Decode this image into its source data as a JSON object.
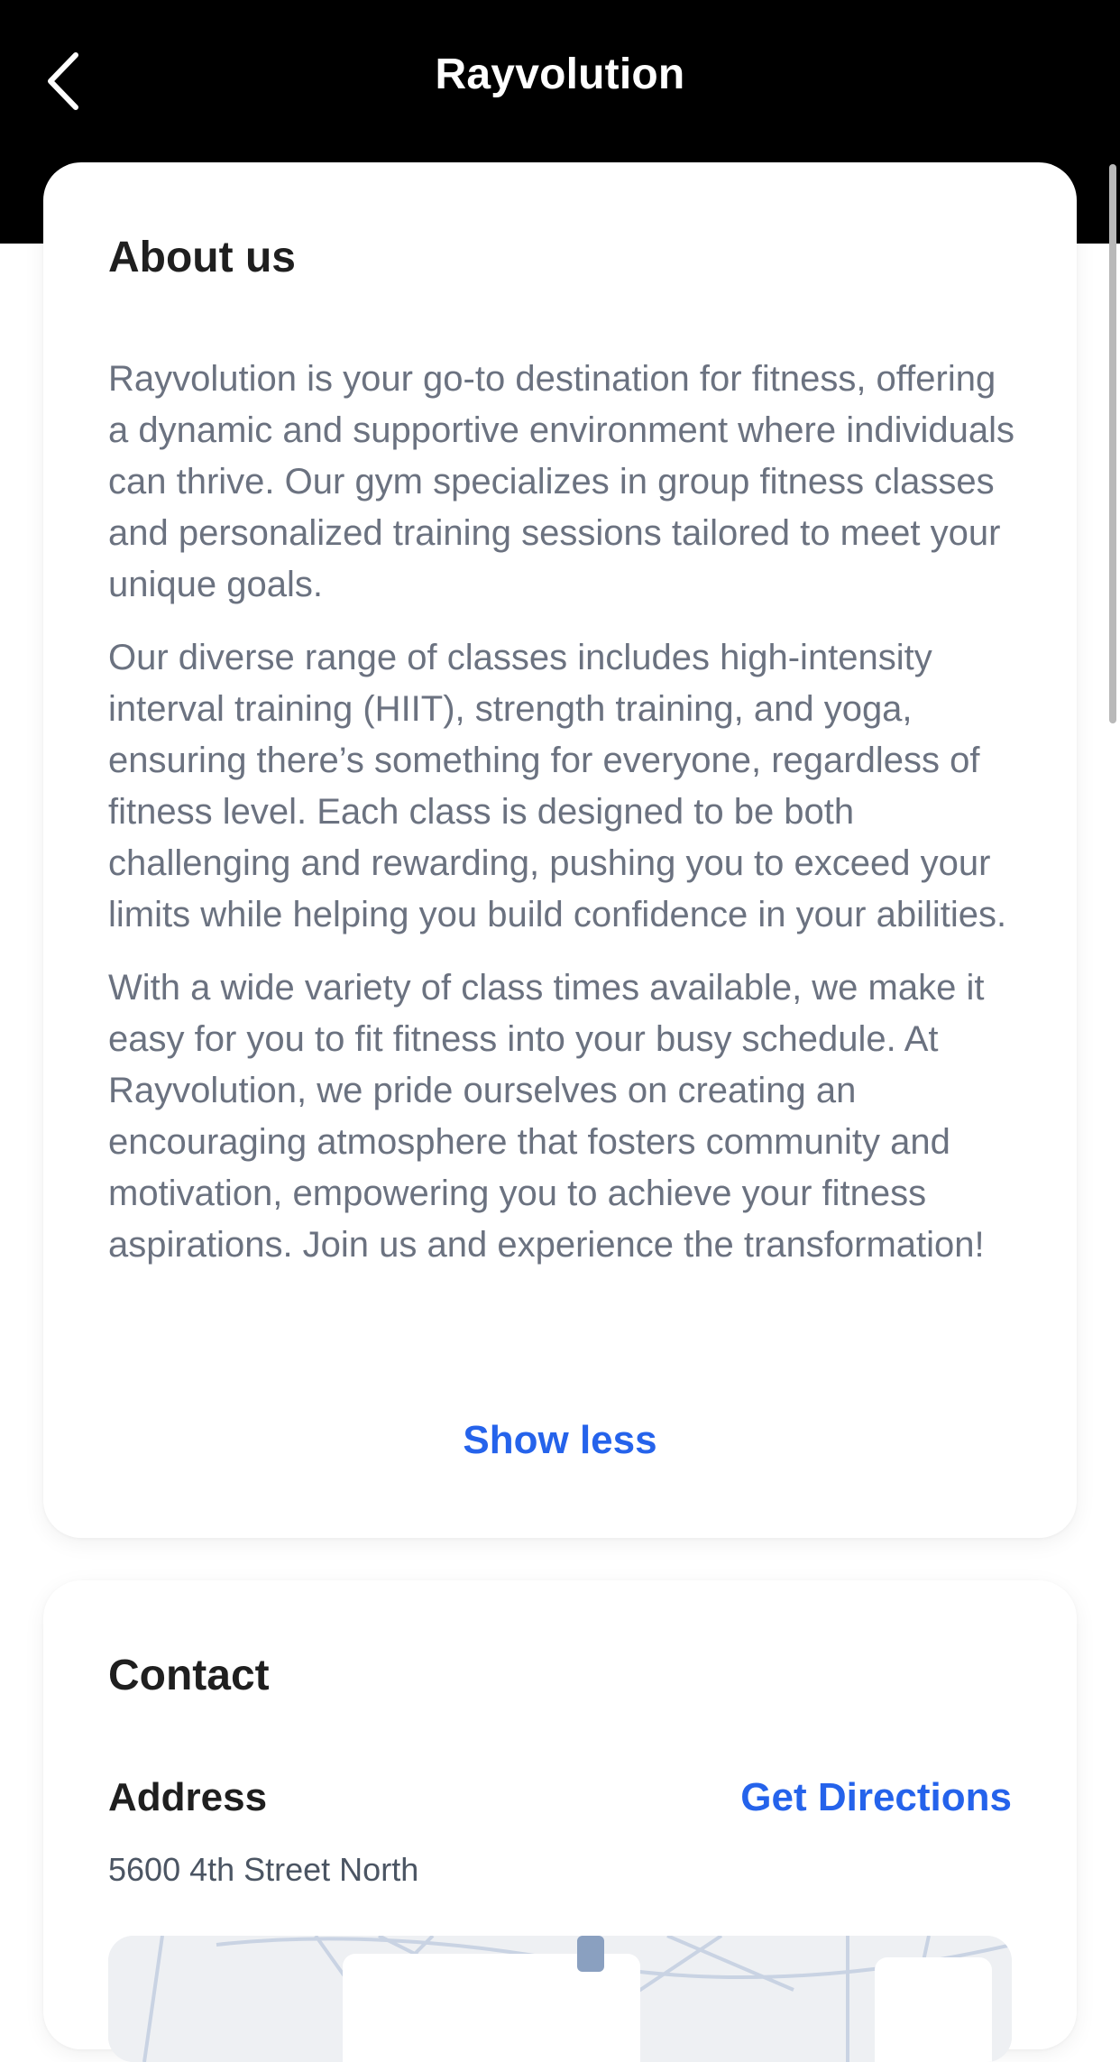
{
  "header": {
    "title": "Rayvolution",
    "back_icon": "chevron-left-icon"
  },
  "about": {
    "heading": "About us",
    "paragraphs": [
      "Rayvolution is your go-to destination for fitness, offering a dynamic and supportive environment where individuals can thrive. Our gym specializes in group fitness classes and personalized training sessions tailored to meet your unique goals.",
      "Our diverse range of classes includes high-intensity interval training (HIIT), strength training, and yoga, ensuring there’s something for everyone, regardless of fitness level. Each class is designed to be both challenging and rewarding, pushing you to exceed your limits while helping you build confidence in your abilities.",
      "With a wide variety of class times available, we make it easy for you to fit fitness into your busy schedule. At Rayvolution, we pride ourselves on creating an encouraging atmosphere that fosters community and motivation, empowering you to achieve your fitness aspirations. Join us and experience the transformation!"
    ],
    "toggle_label": "Show less"
  },
  "contact": {
    "heading": "Contact",
    "address_label": "Address",
    "directions_label": "Get Directions",
    "address": "5600 4th Street North"
  },
  "colors": {
    "header_bg": "#000000",
    "accent": "#2563eb",
    "body_text": "#6b7280",
    "heading_text": "#1f1f1f"
  }
}
